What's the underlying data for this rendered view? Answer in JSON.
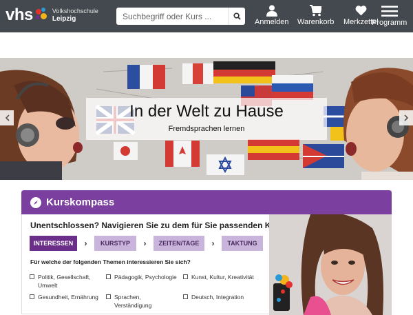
{
  "header": {
    "logo_main": "vhs",
    "logo_line1": "Volkshochschule",
    "logo_line2": "Leipzig",
    "search_placeholder": "Suchbegriff oder Kurs ...",
    "search_icon": "search-icon",
    "nav": [
      {
        "label": "Anmelden",
        "icon": "user-icon"
      },
      {
        "label": "Warenkorb",
        "icon": "cart-icon"
      },
      {
        "label": "Merkzettel",
        "icon": "heart-icon"
      },
      {
        "label": "Programm",
        "icon": "menu-icon"
      }
    ],
    "colors": {
      "bar": "#44494f",
      "logo_dots": [
        "#e2312c",
        "#2a9ad6",
        "#f2b31b",
        "#6d2f8c"
      ]
    }
  },
  "hero": {
    "title": "In der Welt zu Hause",
    "subtitle": "Fremdsprachen lernen",
    "prev_icon": "chevron-left-icon",
    "next_icon": "chevron-right-icon"
  },
  "kurskompass": {
    "title": "Kurskompass",
    "icon": "compass-icon",
    "question": "Unentschlossen? Navigieren Sie zu dem für Sie passenden Kurs.",
    "steps": [
      {
        "label": "INTERESSEN",
        "active": true
      },
      {
        "label": "KURSTYP",
        "active": false
      },
      {
        "label": "ZEITEN/TAGE",
        "active": false
      },
      {
        "label": "TAKTUNG",
        "active": false
      }
    ],
    "themes_question": "Für welche der folgenden Themen interessieren Sie sich?",
    "options": [
      "Politik, Gesellschaft, Umwelt",
      "Pädagogik, Psychologie",
      "Kunst, Kultur, Kreativität",
      "Gesundheit, Ernährung",
      "Sprachen, Verständigung",
      "Deutsch, Integration"
    ],
    "colors": {
      "header": "#7b3fa0",
      "step_active": "#6b2f8a",
      "step_inactive": "#c9b5dc"
    }
  }
}
